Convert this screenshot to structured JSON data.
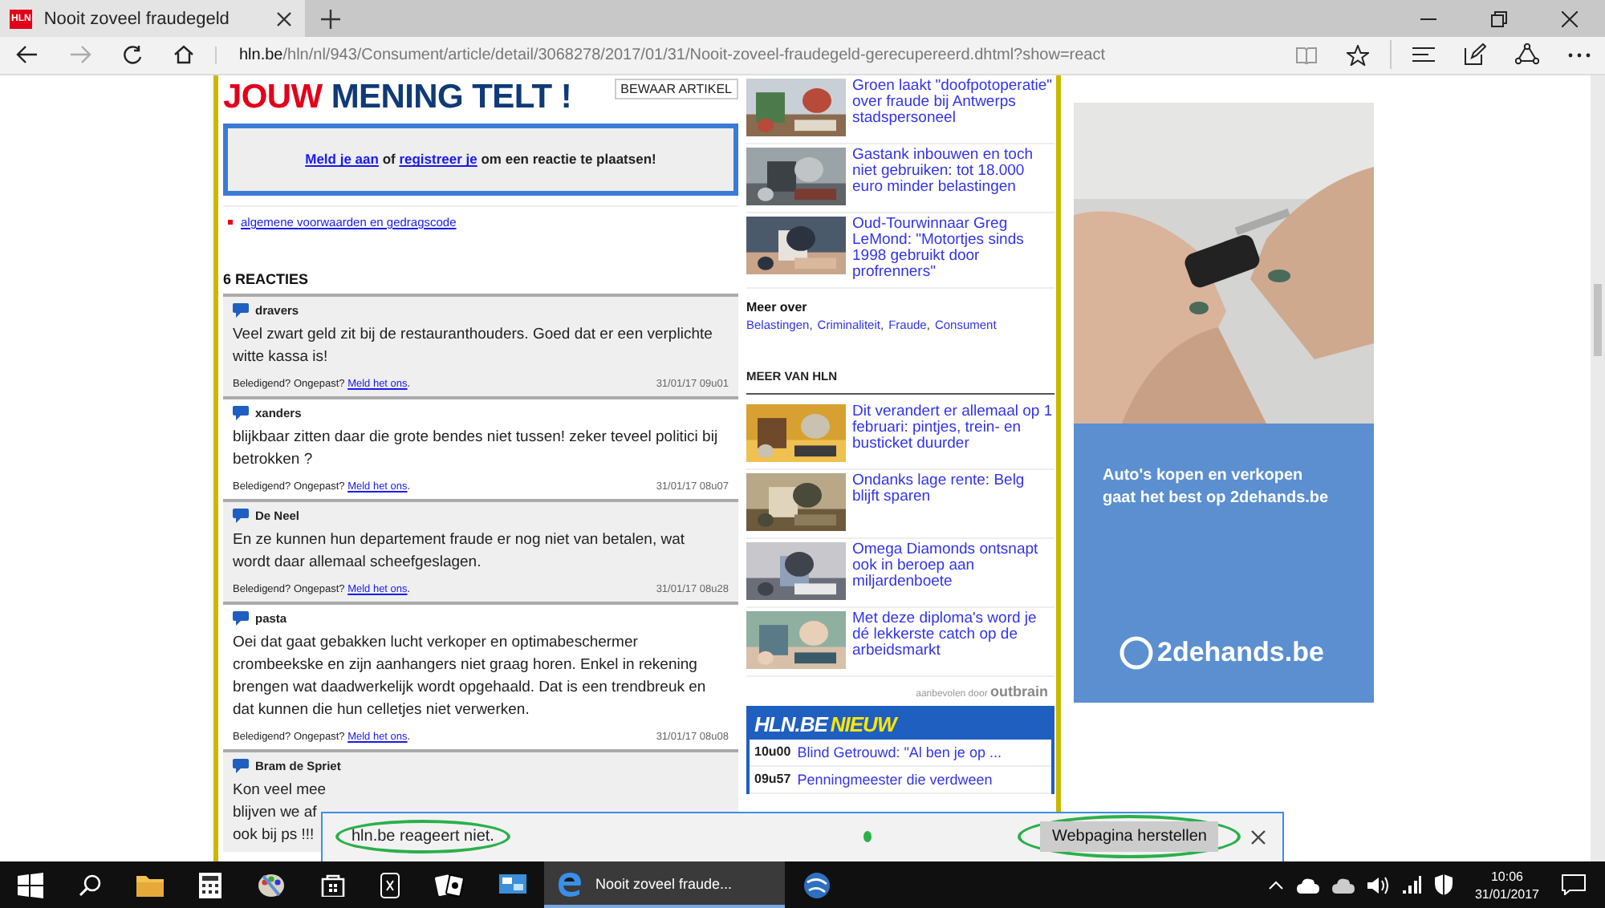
{
  "browser": {
    "tab": {
      "favicon": "HLN",
      "title": "Nooit zoveel fraudegeld",
      "selected": true
    },
    "nav": {
      "forward_disabled": true
    },
    "url_domain": "hln.be",
    "url_path": "/hln/nl/943/Consument/article/detail/3068278/2017/01/31/Nooit-zoveel-fraudegeld-gerecupereerd.dhtml?show=react"
  },
  "article": {
    "title_highlight": "JOUW",
    "title_rest": "MENING TELT !",
    "save_button": "BEWAAR ARTIKEL",
    "login_parts": [
      {
        "kind": "link",
        "text": "Meld je aan"
      },
      {
        "kind": "text",
        "text": " of "
      },
      {
        "kind": "link",
        "text": "registreer je"
      },
      {
        "kind": "text",
        "text": " om een reactie te plaatsen!"
      }
    ],
    "terms_link": "algemene voorwaarden en gedragscode",
    "comments_heading": "6 REACTIES",
    "comments": [
      {
        "author": "dravers",
        "shaded": true,
        "lines": [
          "Veel zwart geld zit bij de restauranthouders. Goed dat er een verplichte",
          "witte kassa is!"
        ],
        "report_prompt": "Beledigend? Ongepast?",
        "report_link": "Meld het ons",
        "report_end": ".",
        "date": "31/01/17 09u01"
      },
      {
        "author": "xanders",
        "shaded": false,
        "lines": [
          "blijkbaar zitten daar die grote bendes niet tussen! zeker teveel politici bij",
          "betrokken ?"
        ],
        "report_prompt": "Beledigend? Ongepast?",
        "report_link": "Meld het ons",
        "report_end": ".",
        "date": "31/01/17 08u07"
      },
      {
        "author": "De Neel",
        "shaded": true,
        "lines": [
          "En ze kunnen hun departement fraude er nog niet van betalen, wat",
          "wordt daar allemaal scheefgeslagen."
        ],
        "report_prompt": "Beledigend? Ongepast?",
        "report_link": "Meld het ons",
        "report_end": ".",
        "date": "31/01/17 08u28"
      },
      {
        "author": "pasta",
        "shaded": false,
        "lines": [
          "Oei dat gaat gebakken lucht verkoper en optimabeschermer",
          "crombeekske en zijn aanhangers niet graag horen. Enkel in rekening",
          "brengen wat daadwerkelijk wordt opgehaald. Dat is een trendbreuk en",
          "dat kunnen die hun celletjes niet verwerken."
        ],
        "report_prompt": "Beledigend? Ongepast?",
        "report_link": "Meld het ons",
        "report_end": ".",
        "date": "31/01/17 08u08"
      },
      {
        "author": "Bram de Spriet",
        "shaded": true,
        "lines": [
          "Kon veel mee",
          "blijven we af",
          "ook bij ps !!!"
        ]
      }
    ]
  },
  "related": {
    "items": [
      {
        "title": "Groen laakt \"doofpotoperatie\" over fraude bij Antwerps stadspersoneel"
      },
      {
        "title": "Gastank inbouwen en toch niet gebruiken: tot 18.000 euro minder belastingen"
      },
      {
        "title": "Oud-Tourwinnaar Greg LeMond: \"Motortjes sinds 1998 gebruikt door profrenners\""
      }
    ],
    "more_label": "Meer over",
    "tags": [
      "Belastingen",
      "Criminaliteit",
      "Fraude",
      "Consument"
    ],
    "tag_separator": ",",
    "more_heading": "MEER VAN HLN",
    "more_items": [
      {
        "title": "Dit verandert er allemaal op 1 februari: pintjes, trein- en busticket duurder"
      },
      {
        "title": "Ondanks lage rente: Belg blijft sparen"
      },
      {
        "title": "Omega Diamonds ontsnapt ook in beroep aan miljardenboete"
      },
      {
        "title": "Met deze diploma's word je dé lekkerste catch op de arbeidsmarkt"
      }
    ],
    "recommended_by": "aanbevolen door",
    "recommender": "outbrain",
    "news": {
      "brand": "HLN.BE",
      "label": "NIEUW",
      "items": [
        {
          "time": "10u00",
          "title": "Blind Getrouwd: \"Al ben je op ..."
        },
        {
          "time": "09u57",
          "title": "Penningmeester die verdween"
        }
      ]
    }
  },
  "ad": {
    "lines": [
      "Auto's kopen en verkopen",
      "gaat het best op 2dehands.be"
    ],
    "logo": "2dehands.be"
  },
  "notification": {
    "message": "hln.be reageert niet.",
    "button": "Webpagina herstellen"
  },
  "taskbar": {
    "active_window": "Nooit zoveel fraude...",
    "time": "10:06",
    "date": "31/01/2017"
  }
}
